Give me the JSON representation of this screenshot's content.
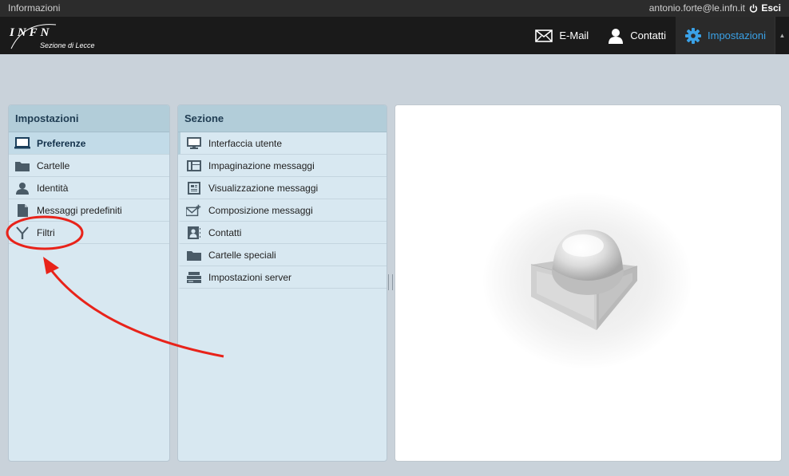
{
  "topbar": {
    "info_label": "Informazioni",
    "user_email": "antonio.forte@le.infn.it",
    "logout_label": "Esci"
  },
  "logo": {
    "mark": "INFN",
    "subtitle": "Sezione di Lecce"
  },
  "nav": {
    "email_label": "E-Mail",
    "contacts_label": "Contatti",
    "settings_label": "Impostazioni",
    "active": "Impostazioni",
    "accent_color": "#3aa1e6"
  },
  "settings_panel": {
    "title": "Impostazioni",
    "items": [
      {
        "label": "Preferenze",
        "icon": "monitor-icon",
        "selected": true
      },
      {
        "label": "Cartelle",
        "icon": "folder-icon"
      },
      {
        "label": "Identità",
        "icon": "identity-icon"
      },
      {
        "label": "Messaggi predefiniti",
        "icon": "document-icon"
      },
      {
        "label": "Filtri",
        "icon": "filter-icon"
      }
    ]
  },
  "section_panel": {
    "title": "Sezione",
    "items": [
      {
        "label": "Interfaccia utente",
        "icon": "monitor-icon"
      },
      {
        "label": "Impaginazione messaggi",
        "icon": "layout-icon"
      },
      {
        "label": "Visualizzazione messaggi",
        "icon": "message-view-icon"
      },
      {
        "label": "Composizione messaggi",
        "icon": "compose-icon"
      },
      {
        "label": "Contatti",
        "icon": "contacts-icon"
      },
      {
        "label": "Cartelle speciali",
        "icon": "folder-icon"
      },
      {
        "label": "Impostazioni server",
        "icon": "server-icon"
      }
    ]
  },
  "annotation": {
    "color": "#e8231a",
    "target": "Filtri"
  }
}
